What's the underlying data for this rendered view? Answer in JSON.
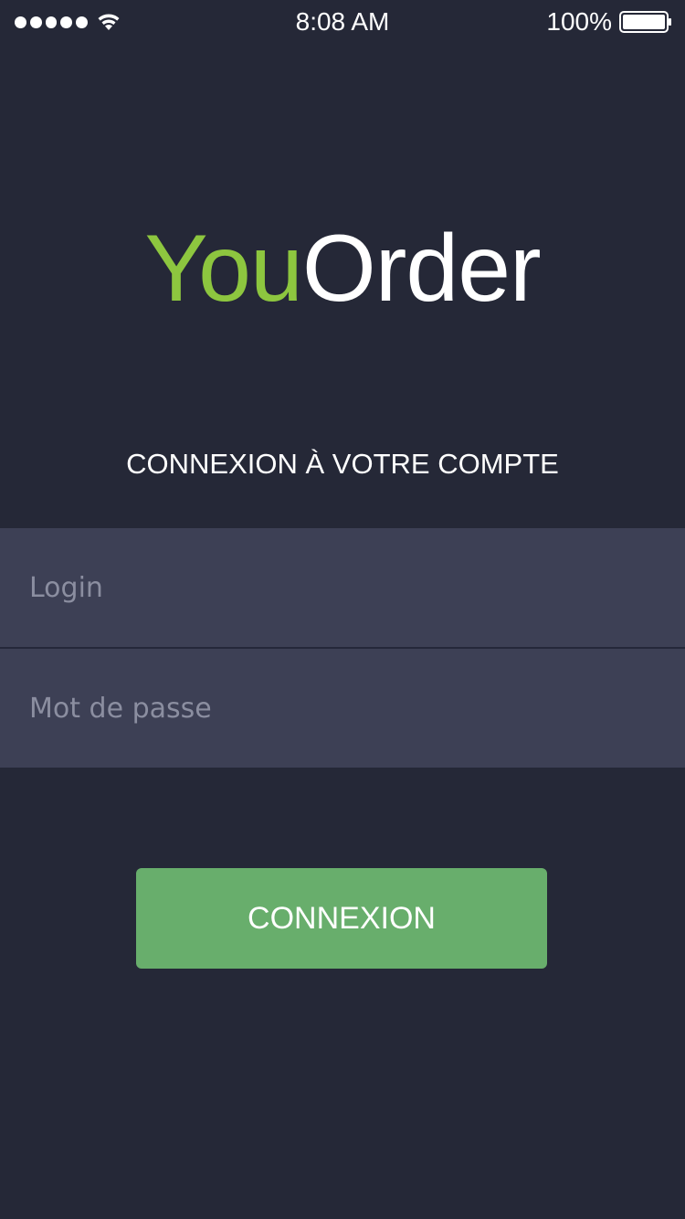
{
  "status_bar": {
    "time": "8:08 AM",
    "battery_percent": "100%",
    "battery_level": 1.0,
    "signal_bars": 5,
    "icons": [
      "signal-dots-icon",
      "wifi-icon",
      "battery-icon"
    ]
  },
  "logo": {
    "part_one": "You",
    "part_two": "Order",
    "colors": {
      "part_one": "#8dc63f",
      "part_two": "#ffffff"
    }
  },
  "heading": "CONNEXION À VOTRE COMPTE",
  "form": {
    "login": {
      "placeholder": "Login",
      "value": ""
    },
    "password": {
      "placeholder": "Mot de passe",
      "value": ""
    },
    "submit_label": "CONNEXION"
  },
  "colors": {
    "background": "#252837",
    "field_background": "#3d4055",
    "placeholder_text": "#8b8ea0",
    "accent": "#8dc63f",
    "button": "#68ae6c"
  }
}
